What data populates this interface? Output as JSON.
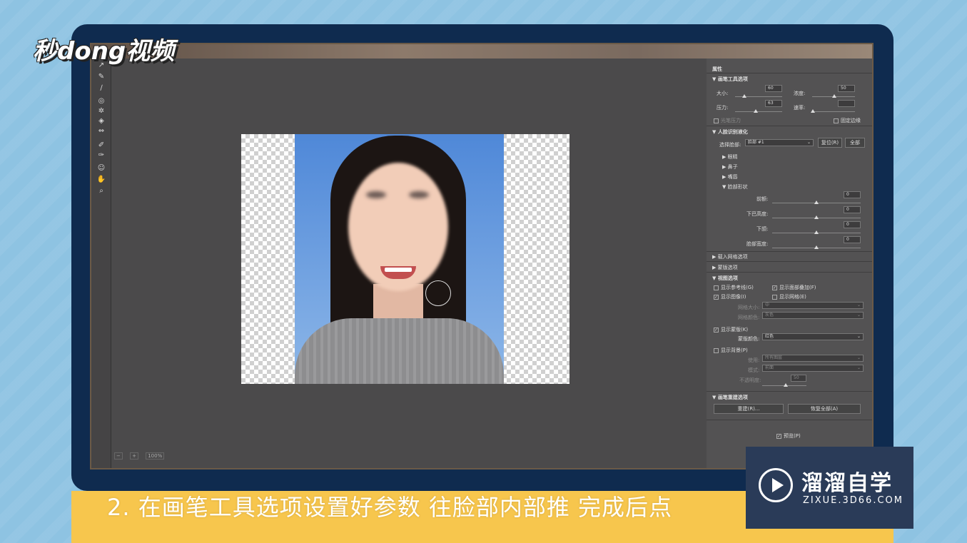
{
  "logo": {
    "text": "秒dong视频"
  },
  "canvas": {
    "zoom": "100%"
  },
  "panel": {
    "title": "属性",
    "brush_section": "▼ 画笔工具选项",
    "size_label": "大小:",
    "size_value": "60",
    "density_label": "浓度:",
    "density_value": "50",
    "pressure_label": "压力:",
    "pressure_value": "63",
    "rate_label": "速率:",
    "stylus_label": "光笔压力",
    "pin_edges_label": "固定边缘",
    "face_section": "▼ 人脸识别液化",
    "select_face_label": "选择脸部:",
    "select_face_value": "脸部 #1",
    "reset_button": "复位(R)",
    "all_button": "全部",
    "eyes_label": "▶ 眼睛",
    "nose_label": "▶ 鼻子",
    "mouth_label": "▶ 嘴唇",
    "face_shape_label": "▼ 脸部形状",
    "forehead_label": "前额:",
    "chin_height_label": "下巴高度:",
    "jawline_label": "下颌:",
    "face_width_label": "脸部宽度:",
    "forehead_value": "0",
    "chin_height_value": "0",
    "jawline_value": "0",
    "face_width_value": "0",
    "load_mesh_section": "▶ 载入网格选项",
    "mask_section": "▶ 蒙版选项",
    "view_section": "▼ 视图选项",
    "show_guides": "显示参考线(G)",
    "show_face_overlay": "显示面部叠加(F)",
    "show_image": "显示图像(I)",
    "show_mesh": "显示网格(E)",
    "mesh_size_label": "网格大小:",
    "mesh_size_value": "中",
    "mesh_color_label": "网格颜色:",
    "mesh_color_value": "灰色",
    "show_mask": "显示蒙版(K)",
    "mask_color_label": "蒙版颜色:",
    "mask_color_value": "红色",
    "show_backdrop": "显示背景(P)",
    "use_label": "使用:",
    "use_value": "所有图层",
    "mode_label": "模式:",
    "mode_value": "前面",
    "opacity_label": "不透明度:",
    "opacity_value": "50",
    "reconstruct_section": "▼ 画笔重建选项",
    "reconstruct_button": "重建(R)...",
    "restore_all_button": "恢复全部(A)",
    "preview_label": "预览(P)"
  },
  "caption": {
    "text": "2. 在画笔工具选项设置好参数 往脸部内部推 完成后点"
  },
  "watermark": {
    "title": "溜溜自学",
    "url": "ZIXUE.3D66.COM"
  }
}
